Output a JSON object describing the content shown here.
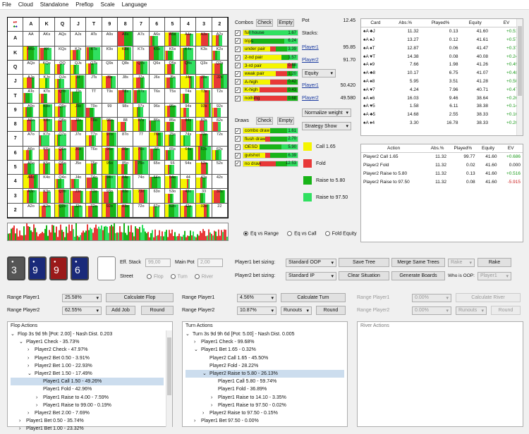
{
  "menu": [
    "File",
    "Cloud",
    "Standalone",
    "Preflop",
    "Scale",
    "Language"
  ],
  "ranks": [
    "A",
    "K",
    "Q",
    "J",
    "T",
    "9",
    "8",
    "7",
    "6",
    "5",
    "4",
    "3",
    "2"
  ],
  "colors": {
    "call": "#f5f500",
    "fold": "#e83838",
    "raise_small": "#18b418",
    "raise_big": "#30e060"
  },
  "combos": {
    "title": "Combos",
    "check": "Check",
    "empty": "Empty",
    "items": [
      {
        "name": "full house",
        "val": "1.67",
        "w": [
          0.1,
          0,
          0,
          0.9
        ]
      },
      {
        "name": "trips",
        "val": "6.24",
        "w": [
          0.15,
          0,
          0.6,
          0.25
        ]
      },
      {
        "name": "under pair",
        "val": "3.39",
        "w": [
          0.5,
          0.1,
          0.2,
          0.2
        ]
      },
      {
        "name": "2-nd pair",
        "val": "1.57",
        "w": [
          0.7,
          0,
          0.15,
          0.15
        ]
      },
      {
        "name": "3-rd pair",
        "val": "0.68",
        "w": [
          0.8,
          0.1,
          0.05,
          0.05
        ]
      },
      {
        "name": "weak pair",
        "val": "1.20",
        "w": [
          0.6,
          0.2,
          0.1,
          0.1
        ]
      },
      {
        "name": "A-high",
        "val": "0.42",
        "w": [
          0.5,
          0.3,
          0.2,
          0
        ]
      },
      {
        "name": "K-high",
        "val": "0.43",
        "w": [
          0.3,
          0.5,
          0.2,
          0
        ]
      },
      {
        "name": "nothing",
        "val": "0.68",
        "w": [
          0.2,
          0.6,
          0.2,
          0
        ]
      }
    ]
  },
  "draws": {
    "title": "Draws",
    "check": "Check",
    "empty": "Empty",
    "items": [
      {
        "name": "combo draw",
        "val": "1.61",
        "w": [
          0.5,
          0,
          0.3,
          0.2
        ]
      },
      {
        "name": "flush draw",
        "val": "2.70",
        "w": [
          0.4,
          0.1,
          0.3,
          0.2
        ]
      },
      {
        "name": "OESD",
        "val": "5.90",
        "w": [
          0.3,
          0,
          0.4,
          0.3
        ]
      },
      {
        "name": "gutshot",
        "val": "6.39",
        "w": [
          0.4,
          0.1,
          0.3,
          0.2
        ]
      },
      {
        "name": "no draw",
        "val": "12.53",
        "w": [
          0.3,
          0.3,
          0.2,
          0.2
        ]
      }
    ]
  },
  "pot": {
    "label": "Pot",
    "value": "12.45",
    "stacks_label": "Stacks:",
    "p1": "Player1",
    "p1v": "95.85",
    "p2": "Player2",
    "p2v": "91.70",
    "equity_sel": "Equity",
    "p1e": "50.420",
    "p2e": "49.580",
    "normalize": "Normalize weight",
    "strategy": "Strategy Show"
  },
  "legend": [
    {
      "label": "Call 1.65",
      "c": "#f5f500"
    },
    {
      "label": "Fold",
      "c": "#e83838"
    },
    {
      "label": "Raise to 5.80",
      "c": "#18b418"
    },
    {
      "label": "Raise to 97.50",
      "c": "#30e060"
    }
  ],
  "card_table": {
    "headers": [
      "Card",
      "Abs.%",
      "Played%",
      "Equity",
      "EV"
    ],
    "rows": [
      [
        "♠A ♣J",
        "11.32",
        "0.13",
        "41.60",
        "+0.516"
      ],
      [
        "♠A ♠J",
        "13.27",
        "0.12",
        "41.61",
        "+0.571"
      ],
      [
        "♠A ♠T",
        "12.87",
        "0.06",
        "41.47",
        "+0.372"
      ],
      [
        "♠A ♥T",
        "14.38",
        "0.08",
        "40.08",
        "+0.240"
      ],
      [
        "♠A ♦9",
        "7.66",
        "1.98",
        "41.26",
        "+0.496"
      ],
      [
        "♠A ♣8",
        "10.17",
        "6.75",
        "41.07",
        "+0.482"
      ],
      [
        "♠A ♠8",
        "5.95",
        "3.51",
        "41.28",
        "+0.505"
      ],
      [
        "♠A ♥7",
        "4.24",
        "7.96",
        "40.71",
        "+0.470"
      ],
      [
        "♠A ♠6",
        "16.03",
        "9.46",
        "38.64",
        "+0.264"
      ],
      [
        "♠A ♥5",
        "1.58",
        "6.11",
        "38.38",
        "+0.144"
      ],
      [
        "♠A ♣5",
        "14.68",
        "2.55",
        "38.33",
        "+0.163"
      ],
      [
        "♠A ♦4",
        "3.30",
        "16.78",
        "38.33",
        "+0.209"
      ]
    ]
  },
  "action_table": {
    "headers": [
      "Action",
      "Abs.%",
      "Played%",
      "Equity",
      "EV"
    ],
    "rows": [
      [
        "Player2 Call 1.65",
        "11.32",
        "99.77",
        "41.60",
        "+0.686"
      ],
      [
        "Player2 Fold",
        "11.32",
        "0.02",
        "41.60",
        "0.000"
      ],
      [
        "Player2 Raise to 5.80",
        "11.32",
        "0.13",
        "41.60",
        "+0.516"
      ],
      [
        "Player2 Raise to 97.50",
        "11.32",
        "0.08",
        "41.60",
        "-5.915"
      ]
    ]
  },
  "view_modes": [
    "Eq vs Range",
    "Eq vs Call",
    "Fold Equity"
  ],
  "board": [
    {
      "r": "3",
      "c": "#555"
    },
    {
      "r": "9",
      "c": "#1a2a7a"
    },
    {
      "r": "9",
      "c": "#9a1a1a"
    },
    {
      "r": "6",
      "c": "#1a2a7a"
    }
  ],
  "board_ctrl": {
    "eff": "Eff. Stack",
    "eff_v": "99,00",
    "main": "Main Pot",
    "main_v": "2,00",
    "street": "Street",
    "streets": [
      "Flop",
      "Turn",
      "River"
    ]
  },
  "sizing": {
    "p1": "Player1 bet sizing:",
    "p1v": "Standard OOP",
    "p2": "Player2 bet sizing:",
    "p2v": "Standard IP",
    "save": "Save Tree",
    "merge": "Merge Same Trees",
    "rake_sel": "Rake",
    "rake": "Rake",
    "clear": "Clear Situation",
    "gen": "Generate Boards",
    "oop": "Who is OOP:",
    "oop_v": "Player1"
  },
  "flop_ctrl": {
    "r1": "Range Player1",
    "r1v": "25.58%",
    "calc": "Calculate Flop",
    "r2": "Range Player2",
    "r2v": "62.55%",
    "add": "Add Job",
    "round": "Round"
  },
  "turn_ctrl": {
    "r1": "Range Player1",
    "r1v": "4.56%",
    "calc": "Calculate Turn",
    "r2": "Range Player2",
    "r2v": "10.87%",
    "runouts": "Runouts",
    "round": "Round"
  },
  "river_ctrl": {
    "r1": "Range Player1",
    "r1v": "0.00%",
    "calc": "Calculate River",
    "r2": "Range Player2",
    "r2v": "0.00%",
    "runouts": "Runouts",
    "round": "Round"
  },
  "flop_tree": {
    "title": "Flop Actions",
    "lines": [
      {
        "d": 0,
        "t": "Flop 3s 9d 9h [Pot: 2.00] - Nash Dist. 0.203",
        "a": "v"
      },
      {
        "d": 1,
        "t": "Player1 Check - 35.73%",
        "a": "v"
      },
      {
        "d": 2,
        "t": "Player2 Check - 47.97%",
        "a": ">"
      },
      {
        "d": 2,
        "t": "Player2 Bet 0.50 - 3.91%",
        "a": ">"
      },
      {
        "d": 2,
        "t": "Player2 Bet 1.00 - 22.93%",
        "a": ">"
      },
      {
        "d": 2,
        "t": "Player2 Bet 1.50 - 17.49%",
        "a": "v"
      },
      {
        "d": 3,
        "t": "Player1 Call 1.50 - 49.26%",
        "a": "",
        "h": true
      },
      {
        "d": 3,
        "t": "Player1 Fold - 42.96%",
        "a": ""
      },
      {
        "d": 3,
        "t": "Player1 Raise to 4.00 - 7.59%",
        "a": ">"
      },
      {
        "d": 3,
        "t": "Player1 Raise to 99.00 - 0.19%",
        "a": ">"
      },
      {
        "d": 2,
        "t": "Player2 Bet 2.00 - 7.69%",
        "a": ">"
      },
      {
        "d": 1,
        "t": "Player1 Bet 0.50 - 35.74%",
        "a": ">"
      },
      {
        "d": 1,
        "t": "Player1 Bet 1.00 - 23.32%",
        "a": ">"
      }
    ]
  },
  "turn_tree": {
    "title": "Turn Actions",
    "lines": [
      {
        "d": 0,
        "t": "Turn 3s 9d 9h 6d [Pot: 5.00] - Nash Dist. 0.005",
        "a": "v"
      },
      {
        "d": 1,
        "t": "Player1 Check - 99.68%",
        "a": ">"
      },
      {
        "d": 1,
        "t": "Player1 Bet 1.65 - 0.32%",
        "a": "v"
      },
      {
        "d": 2,
        "t": "Player2 Call 1.65 - 45.50%",
        "a": ""
      },
      {
        "d": 2,
        "t": "Player2 Fold - 28.22%",
        "a": ""
      },
      {
        "d": 2,
        "t": "Player2 Raise to 5.80 - 26.13%",
        "a": "v",
        "h": true
      },
      {
        "d": 3,
        "t": "Player1 Call 5.80 - 59.74%",
        "a": ""
      },
      {
        "d": 3,
        "t": "Player1 Fold - 36.89%",
        "a": ""
      },
      {
        "d": 3,
        "t": "Player1 Raise to 14.10 - 3.35%",
        "a": ">"
      },
      {
        "d": 3,
        "t": "Player1 Raise to 97.50 - 0.02%",
        "a": ">"
      },
      {
        "d": 2,
        "t": "Player2 Raise to 97.50 - 0.15%",
        "a": ">"
      },
      {
        "d": 1,
        "t": "Player1 Bet 97.50 - 0.00%",
        "a": ">"
      }
    ]
  },
  "river_tree": {
    "title": "River Actions"
  }
}
